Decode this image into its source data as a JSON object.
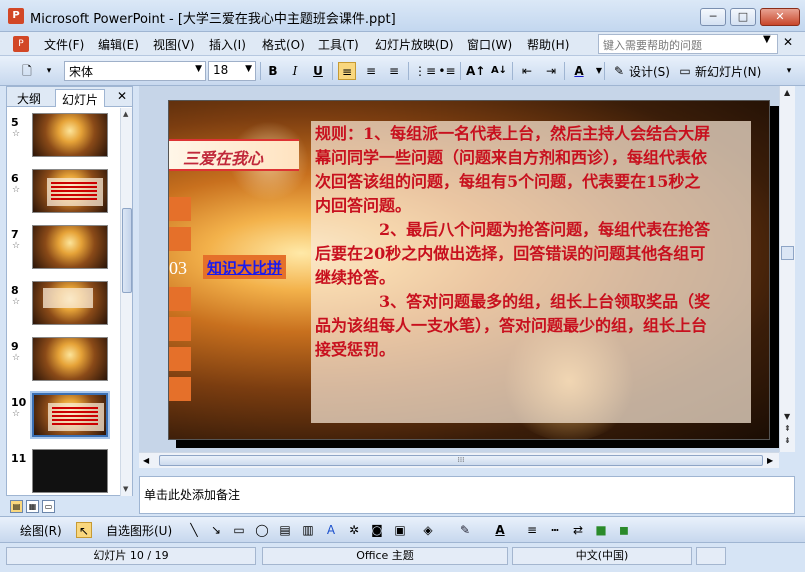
{
  "window": {
    "app_icon": "P",
    "title": "Microsoft PowerPoint - [大学三爱在我心中主题班会课件.ppt]",
    "min": "─",
    "max": "□",
    "close": "✕"
  },
  "menu": {
    "items": [
      "文件(F)",
      "编辑(E)",
      "视图(V)",
      "插入(I)",
      "格式(O)",
      "工具(T)",
      "幻灯片放映(D)",
      "窗口(W)",
      "帮助(H)"
    ],
    "help_placeholder": "键入需要帮助的问题"
  },
  "toolbar": {
    "font_name": "宋体",
    "font_size": "18",
    "bold": "B",
    "italic": "I",
    "underline": "U",
    "design_label": "设计(S)",
    "new_slide_label": "新幻灯片(N)"
  },
  "left_pane": {
    "tab_outline": "大纲",
    "tab_slides": "幻灯片",
    "close": "✕",
    "slides": [
      {
        "num": "5"
      },
      {
        "num": "6"
      },
      {
        "num": "7"
      },
      {
        "num": "8"
      },
      {
        "num": "9"
      },
      {
        "num": "10"
      },
      {
        "num": "11"
      }
    ],
    "selected": "10"
  },
  "slide": {
    "banner": "三爱在我心",
    "section_num": "03",
    "section_label": "知识大比拼",
    "rules_p1": "规则：1、每组派一名代表上台，然后主持人会结合大屏幕问同学一些问题（问题来自方剂和西诊），每组代表依次回答该组的问题，每组有5个问题，代表要在15秒之内回答问题。",
    "rules_p2": "2、最后八个问题为抢答问题，每组代表在抢答后要在20秒之内做出选择，回答错误的问题其他各组可继续抢答。",
    "rules_p3": "3、答对问题最多的组，组长上台领取奖品（奖品为该组每人一支水笔），答对问题最少的组，组长上台接受惩罚。"
  },
  "notes": {
    "placeholder": "单击此处添加备注"
  },
  "drawbar": {
    "draw_label": "绘图(R)",
    "autoshape_label": "自选图形(U)"
  },
  "status": {
    "slide_info": "幻灯片 10 / 19",
    "theme": "Office 主题",
    "language": "中文(中国)"
  }
}
